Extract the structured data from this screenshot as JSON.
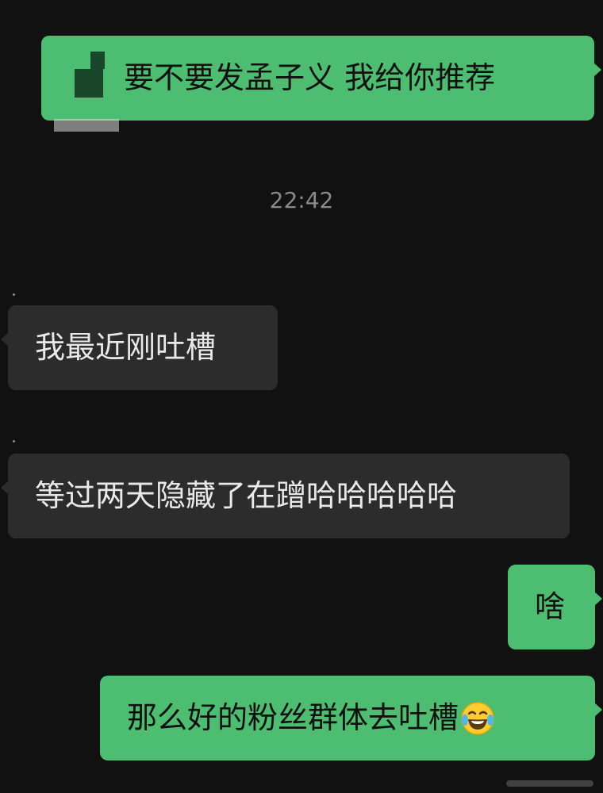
{
  "conversation": {
    "timestamp": "22:42",
    "messages": [
      {
        "id": "m1",
        "side": "sent",
        "text": "要不要发孟子义 我给你推荐"
      },
      {
        "id": "m2",
        "side": "received",
        "text": "我最近刚吐槽"
      },
      {
        "id": "m3",
        "side": "received",
        "text": "等过两天隐藏了在蹭哈哈哈哈哈"
      },
      {
        "id": "m4",
        "side": "sent",
        "text": "啥"
      },
      {
        "id": "m5",
        "side": "sent",
        "text": "那么好的粉丝群体去吐槽"
      }
    ]
  },
  "emoji": {
    "name": "tears-of-joy-emoji"
  },
  "colors": {
    "background": "#111111",
    "sent_bubble": "#4dbe71",
    "received_bubble": "#2c2c2c",
    "timestamp": "#8a8a8a"
  }
}
